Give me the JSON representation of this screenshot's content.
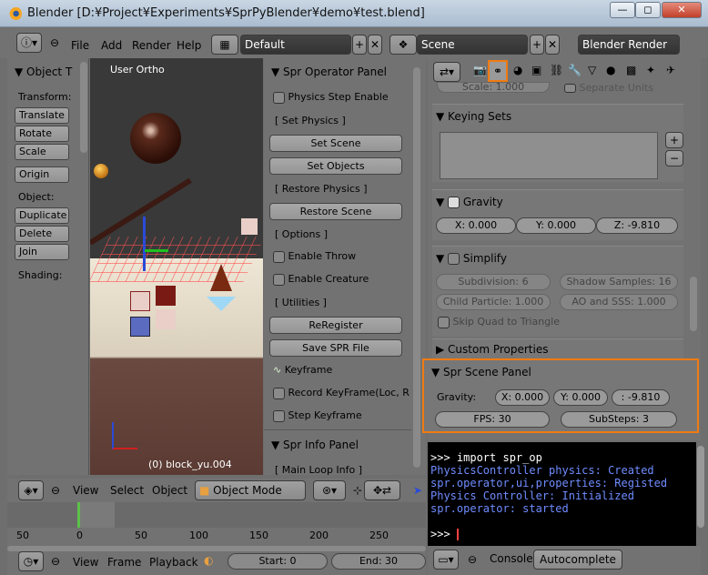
{
  "window": {
    "title": "Blender [D:¥Project¥Experiments¥SprPyBlender¥demo¥test.blend]",
    "min": "—",
    "max": "◻",
    "close": "✕"
  },
  "info_header": {
    "menus": [
      "File",
      "Add",
      "Render",
      "Help"
    ],
    "layout": "Default",
    "scene": "Scene",
    "engine": "Blender Render"
  },
  "tool_shelf": {
    "title": "Object T",
    "transform_label": "Transform:",
    "transform_buttons": [
      "Translate",
      "Rotate",
      "Scale"
    ],
    "origin": "Origin",
    "object_label": "Object:",
    "object_buttons": [
      "Duplicate",
      "Delete",
      "Join"
    ],
    "shading_label": "Shading:"
  },
  "viewport": {
    "view_label": "User Ortho",
    "object_label": "(0) block_yu.004"
  },
  "spr_operator_panel": {
    "title": "Spr Operator Panel",
    "physics_step": "Physics Step Enable",
    "set_physics_label": "[ Set Physics ]",
    "set_scene": "Set Scene",
    "set_objects": "Set Objects",
    "restore_label": "[ Restore Physics ]",
    "restore_scene": "Restore Scene",
    "options_label": "[ Options ]",
    "enable_throw": "Enable Throw",
    "enable_creature": "Enable Creature",
    "utilities_label": "[ Utilities ]",
    "reregister": "ReRegister",
    "save_spr": "Save SPR File",
    "keyframe": "Keyframe",
    "record_keyframe": "Record KeyFrame(Loc, R",
    "step_keyframe": "Step Keyframe",
    "info_title": "Spr Info Panel",
    "main_loop": "[ Main Loop Info ]"
  },
  "properties": {
    "top_scale": "Scale: 1.000",
    "separate_units": "Separate Units",
    "keying_sets": "Keying Sets",
    "gravity_title": "Gravity",
    "gravity": {
      "x": "X: 0.000",
      "y": "Y: 0.000",
      "z": "Z: -9.810"
    },
    "simplify_title": "Simplify",
    "subdivision": "Subdivision: 6",
    "shadow_samples": "Shadow Samples: 16",
    "child_particle": "Child Particle: 1.000",
    "ao_sss": "AO and SSS: 1.000",
    "skip_quad": "Skip Quad to Triangle",
    "custom_props": "Custom Properties",
    "spr_scene_title": "Spr Scene Panel",
    "gravity_label": "Gravity:",
    "spr_gravity": {
      "x": "X: 0.000",
      "y": "Y: 0.000",
      "z": ": -9.810"
    },
    "fps": "FPS: 30",
    "substeps": "SubSteps: 3"
  },
  "console": {
    "lines": [
      {
        "text": ">>> import spr_op",
        "color": "#ffffff"
      },
      {
        "text": "PhysicsController physics: Created",
        "color": "#6f8cff"
      },
      {
        "text": "spr.operator,ui,properties: Registed",
        "color": "#6f8cff"
      },
      {
        "text": "Physics Controller: Initialized",
        "color": "#6f8cff"
      },
      {
        "text": "spr.operator: started",
        "color": "#6f8cff"
      }
    ],
    "prompt": ">>> ",
    "footer_console": "Console",
    "footer_autocomplete": "Autocomplete"
  },
  "view3d_header": {
    "menus": [
      "View",
      "Select",
      "Object"
    ],
    "mode": "Object Mode"
  },
  "timeline": {
    "ruler": [
      "50",
      "0",
      "50",
      "100",
      "150",
      "200",
      "250"
    ],
    "menus": [
      "View",
      "Frame",
      "Playback"
    ],
    "start": "Start: 0",
    "end": "End: 30"
  },
  "accent_color": "#f07b12"
}
